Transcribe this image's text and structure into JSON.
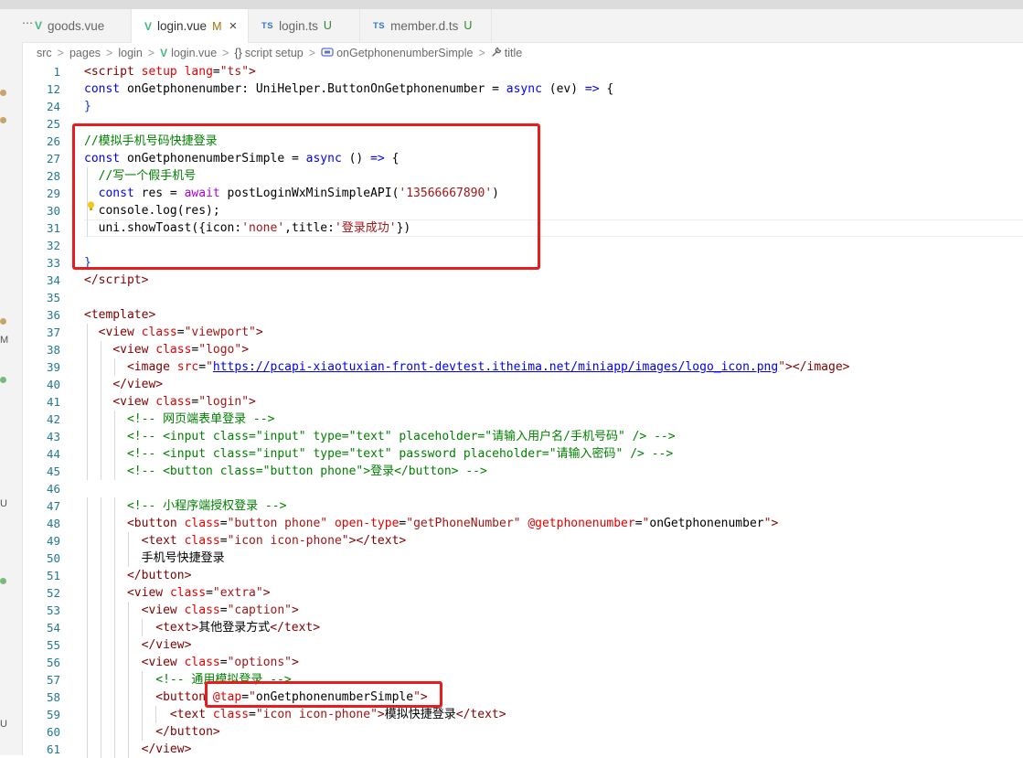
{
  "tabs": [
    {
      "label": "goods.vue",
      "icon": "vue",
      "status": "",
      "active": false
    },
    {
      "label": "login.vue",
      "icon": "vue",
      "status": "M",
      "active": true
    },
    {
      "label": "login.ts",
      "icon": "ts",
      "status": "U",
      "active": false
    },
    {
      "label": "member.d.ts",
      "icon": "ts",
      "status": "U",
      "active": false
    }
  ],
  "tab_close": "×",
  "tab_overflow": "⋯",
  "ts_badge": "TS",
  "vue_badge": "V",
  "breadcrumb": {
    "items": [
      "src",
      "pages",
      "login",
      "login.vue",
      "script setup",
      "onGetphonenumberSimple",
      "title"
    ],
    "separator": ">"
  },
  "activity_letters": [
    "M",
    "U",
    "U"
  ],
  "code_lines": [
    {
      "n": "1",
      "t": [
        [
          "tag",
          "<"
        ],
        [
          "tag",
          "script"
        ],
        [
          "pu",
          " "
        ],
        [
          "attr",
          "setup"
        ],
        [
          "pu",
          " "
        ],
        [
          "attr",
          "lang"
        ],
        [
          "pu",
          "="
        ],
        [
          "str",
          "\"ts\""
        ],
        [
          "tag",
          ">"
        ]
      ]
    },
    {
      "n": "12",
      "t": [
        [
          "kw",
          "const"
        ],
        [
          "pu",
          " onGetphonenumber: UniHelper.ButtonOnGetphonenumber = "
        ],
        [
          "kw",
          "async"
        ],
        [
          "pu",
          " (ev) "
        ],
        [
          "kw",
          "=>"
        ],
        [
          "pu",
          " {"
        ]
      ]
    },
    {
      "n": "24",
      "t": [
        [
          "br",
          "}"
        ]
      ]
    },
    {
      "n": "25",
      "t": []
    },
    {
      "n": "26",
      "t": [
        [
          "cm",
          "//模拟手机号码快捷登录"
        ]
      ]
    },
    {
      "n": "27",
      "t": [
        [
          "kw",
          "const"
        ],
        [
          "pu",
          " onGetphonenumberSimple = "
        ],
        [
          "kw",
          "async"
        ],
        [
          "pu",
          " () "
        ],
        [
          "kw",
          "=>"
        ],
        [
          "pu",
          " {"
        ]
      ]
    },
    {
      "n": "28",
      "t": [
        [
          "cm",
          "  //写一个假手机号"
        ]
      ]
    },
    {
      "n": "29",
      "t": [
        [
          "pu",
          "  "
        ],
        [
          "kw",
          "const"
        ],
        [
          "pu",
          " res = "
        ],
        [
          "ctl",
          "await"
        ],
        [
          "pu",
          " postLoginWxMinSimpleAPI("
        ],
        [
          "str",
          "'13566667890'"
        ],
        [
          "pu",
          ")"
        ]
      ]
    },
    {
      "n": "30",
      "t": [
        [
          "pu",
          "  console.log(res);"
        ]
      ]
    },
    {
      "n": "31",
      "t": [
        [
          "pu",
          "  uni.showToast({icon:"
        ],
        [
          "str",
          "'none'"
        ],
        [
          "pu",
          ",title:"
        ],
        [
          "str",
          "'登录成功'"
        ],
        [
          "pu",
          "})"
        ]
      ]
    },
    {
      "n": "32",
      "t": []
    },
    {
      "n": "33",
      "t": [
        [
          "br",
          "}"
        ]
      ]
    },
    {
      "n": "34",
      "t": [
        [
          "tag",
          "</"
        ],
        [
          "tag",
          "script"
        ],
        [
          "tag",
          ">"
        ]
      ]
    },
    {
      "n": "35",
      "t": []
    },
    {
      "n": "36",
      "t": [
        [
          "tag",
          "<"
        ],
        [
          "tag",
          "template"
        ],
        [
          "tag",
          ">"
        ]
      ]
    },
    {
      "n": "37",
      "t": [
        [
          "pu",
          "  "
        ],
        [
          "tag",
          "<view"
        ],
        [
          "pu",
          " "
        ],
        [
          "attr",
          "class"
        ],
        [
          "pu",
          "="
        ],
        [
          "str",
          "\"viewport\""
        ],
        [
          "tag",
          ">"
        ]
      ]
    },
    {
      "n": "38",
      "t": [
        [
          "pu",
          "    "
        ],
        [
          "tag",
          "<view"
        ],
        [
          "pu",
          " "
        ],
        [
          "attr",
          "class"
        ],
        [
          "pu",
          "="
        ],
        [
          "str",
          "\"logo\""
        ],
        [
          "tag",
          ">"
        ]
      ]
    },
    {
      "n": "39",
      "t": [
        [
          "pu",
          "      "
        ],
        [
          "tag",
          "<image"
        ],
        [
          "pu",
          " "
        ],
        [
          "attr",
          "src"
        ],
        [
          "pu",
          "="
        ],
        [
          "str",
          "\""
        ],
        [
          "url",
          "https://pcapi-xiaotuxian-front-devtest.itheima.net/miniapp/images/logo_icon.png"
        ],
        [
          "str",
          "\""
        ],
        [
          "tag",
          "></image>"
        ]
      ]
    },
    {
      "n": "40",
      "t": [
        [
          "pu",
          "    "
        ],
        [
          "tag",
          "</view>"
        ]
      ]
    },
    {
      "n": "41",
      "t": [
        [
          "pu",
          "    "
        ],
        [
          "tag",
          "<view"
        ],
        [
          "pu",
          " "
        ],
        [
          "attr",
          "class"
        ],
        [
          "pu",
          "="
        ],
        [
          "str",
          "\"login\""
        ],
        [
          "tag",
          ">"
        ]
      ]
    },
    {
      "n": "42",
      "t": [
        [
          "cm",
          "      <!-- 网页端表单登录 -->"
        ]
      ]
    },
    {
      "n": "43",
      "t": [
        [
          "cm",
          "      <!-- <input class=\"input\" type=\"text\" placeholder=\"请输入用户名/手机号码\" /> -->"
        ]
      ]
    },
    {
      "n": "44",
      "t": [
        [
          "cm",
          "      <!-- <input class=\"input\" type=\"text\" password placeholder=\"请输入密码\" /> -->"
        ]
      ]
    },
    {
      "n": "45",
      "t": [
        [
          "cm",
          "      <!-- <button class=\"button phone\">登录</button> -->"
        ]
      ]
    },
    {
      "n": "46",
      "t": []
    },
    {
      "n": "47",
      "t": [
        [
          "cm",
          "      <!-- 小程序端授权登录 -->"
        ]
      ]
    },
    {
      "n": "48",
      "t": [
        [
          "pu",
          "      "
        ],
        [
          "tag",
          "<button"
        ],
        [
          "pu",
          " "
        ],
        [
          "attr",
          "class"
        ],
        [
          "pu",
          "="
        ],
        [
          "str",
          "\"button phone\""
        ],
        [
          "pu",
          " "
        ],
        [
          "attr",
          "open-type"
        ],
        [
          "pu",
          "="
        ],
        [
          "str",
          "\"getPhoneNumber\""
        ],
        [
          "pu",
          " "
        ],
        [
          "attr",
          "@getphonenumber"
        ],
        [
          "pu",
          "="
        ],
        [
          "str",
          "\""
        ],
        [
          "pu",
          "onGetphonenumber"
        ],
        [
          "str",
          "\""
        ],
        [
          "tag",
          ">"
        ]
      ]
    },
    {
      "n": "49",
      "t": [
        [
          "pu",
          "        "
        ],
        [
          "tag",
          "<text"
        ],
        [
          "pu",
          " "
        ],
        [
          "attr",
          "class"
        ],
        [
          "pu",
          "="
        ],
        [
          "str",
          "\"icon icon-phone\""
        ],
        [
          "tag",
          "></text>"
        ]
      ]
    },
    {
      "n": "50",
      "t": [
        [
          "pu",
          "        手机号快捷登录"
        ]
      ]
    },
    {
      "n": "51",
      "t": [
        [
          "pu",
          "      "
        ],
        [
          "tag",
          "</button>"
        ]
      ]
    },
    {
      "n": "52",
      "t": [
        [
          "pu",
          "      "
        ],
        [
          "tag",
          "<view"
        ],
        [
          "pu",
          " "
        ],
        [
          "attr",
          "class"
        ],
        [
          "pu",
          "="
        ],
        [
          "str",
          "\"extra\""
        ],
        [
          "tag",
          ">"
        ]
      ]
    },
    {
      "n": "53",
      "t": [
        [
          "pu",
          "        "
        ],
        [
          "tag",
          "<view"
        ],
        [
          "pu",
          " "
        ],
        [
          "attr",
          "class"
        ],
        [
          "pu",
          "="
        ],
        [
          "str",
          "\"caption\""
        ],
        [
          "tag",
          ">"
        ]
      ]
    },
    {
      "n": "54",
      "t": [
        [
          "pu",
          "          "
        ],
        [
          "tag",
          "<text>"
        ],
        [
          "pu",
          "其他登录方式"
        ],
        [
          "tag",
          "</text>"
        ]
      ]
    },
    {
      "n": "55",
      "t": [
        [
          "pu",
          "        "
        ],
        [
          "tag",
          "</view>"
        ]
      ]
    },
    {
      "n": "56",
      "t": [
        [
          "pu",
          "        "
        ],
        [
          "tag",
          "<view"
        ],
        [
          "pu",
          " "
        ],
        [
          "attr",
          "class"
        ],
        [
          "pu",
          "="
        ],
        [
          "str",
          "\"options\""
        ],
        [
          "tag",
          ">"
        ]
      ]
    },
    {
      "n": "57",
      "t": [
        [
          "cm",
          "          <!-- 通用模拟登录 -->"
        ]
      ]
    },
    {
      "n": "58",
      "t": [
        [
          "pu",
          "          "
        ],
        [
          "tag",
          "<button"
        ],
        [
          "pu",
          " "
        ],
        [
          "attr",
          "@tap"
        ],
        [
          "pu",
          "="
        ],
        [
          "str",
          "\""
        ],
        [
          "pu",
          "onGetphonenumberSimple"
        ],
        [
          "str",
          "\""
        ],
        [
          "tag",
          ">"
        ]
      ]
    },
    {
      "n": "59",
      "t": [
        [
          "pu",
          "            "
        ],
        [
          "tag",
          "<text"
        ],
        [
          "pu",
          " "
        ],
        [
          "attr",
          "class"
        ],
        [
          "pu",
          "="
        ],
        [
          "str",
          "\"icon icon-phone\""
        ],
        [
          "tag",
          ">"
        ],
        [
          "pu",
          "模拟快捷登录"
        ],
        [
          "tag",
          "</text>"
        ]
      ]
    },
    {
      "n": "60",
      "t": [
        [
          "pu",
          "          "
        ],
        [
          "tag",
          "</button>"
        ]
      ]
    },
    {
      "n": "61",
      "t": [
        [
          "pu",
          "        "
        ],
        [
          "tag",
          "</view>"
        ]
      ]
    }
  ],
  "colors": {
    "highlight_box": "#e81c1c",
    "line_number": "#237893",
    "keyword": "#0000ff",
    "string": "#a31515",
    "comment": "#008000",
    "tag": "#800000",
    "attribute": "#e50000"
  }
}
